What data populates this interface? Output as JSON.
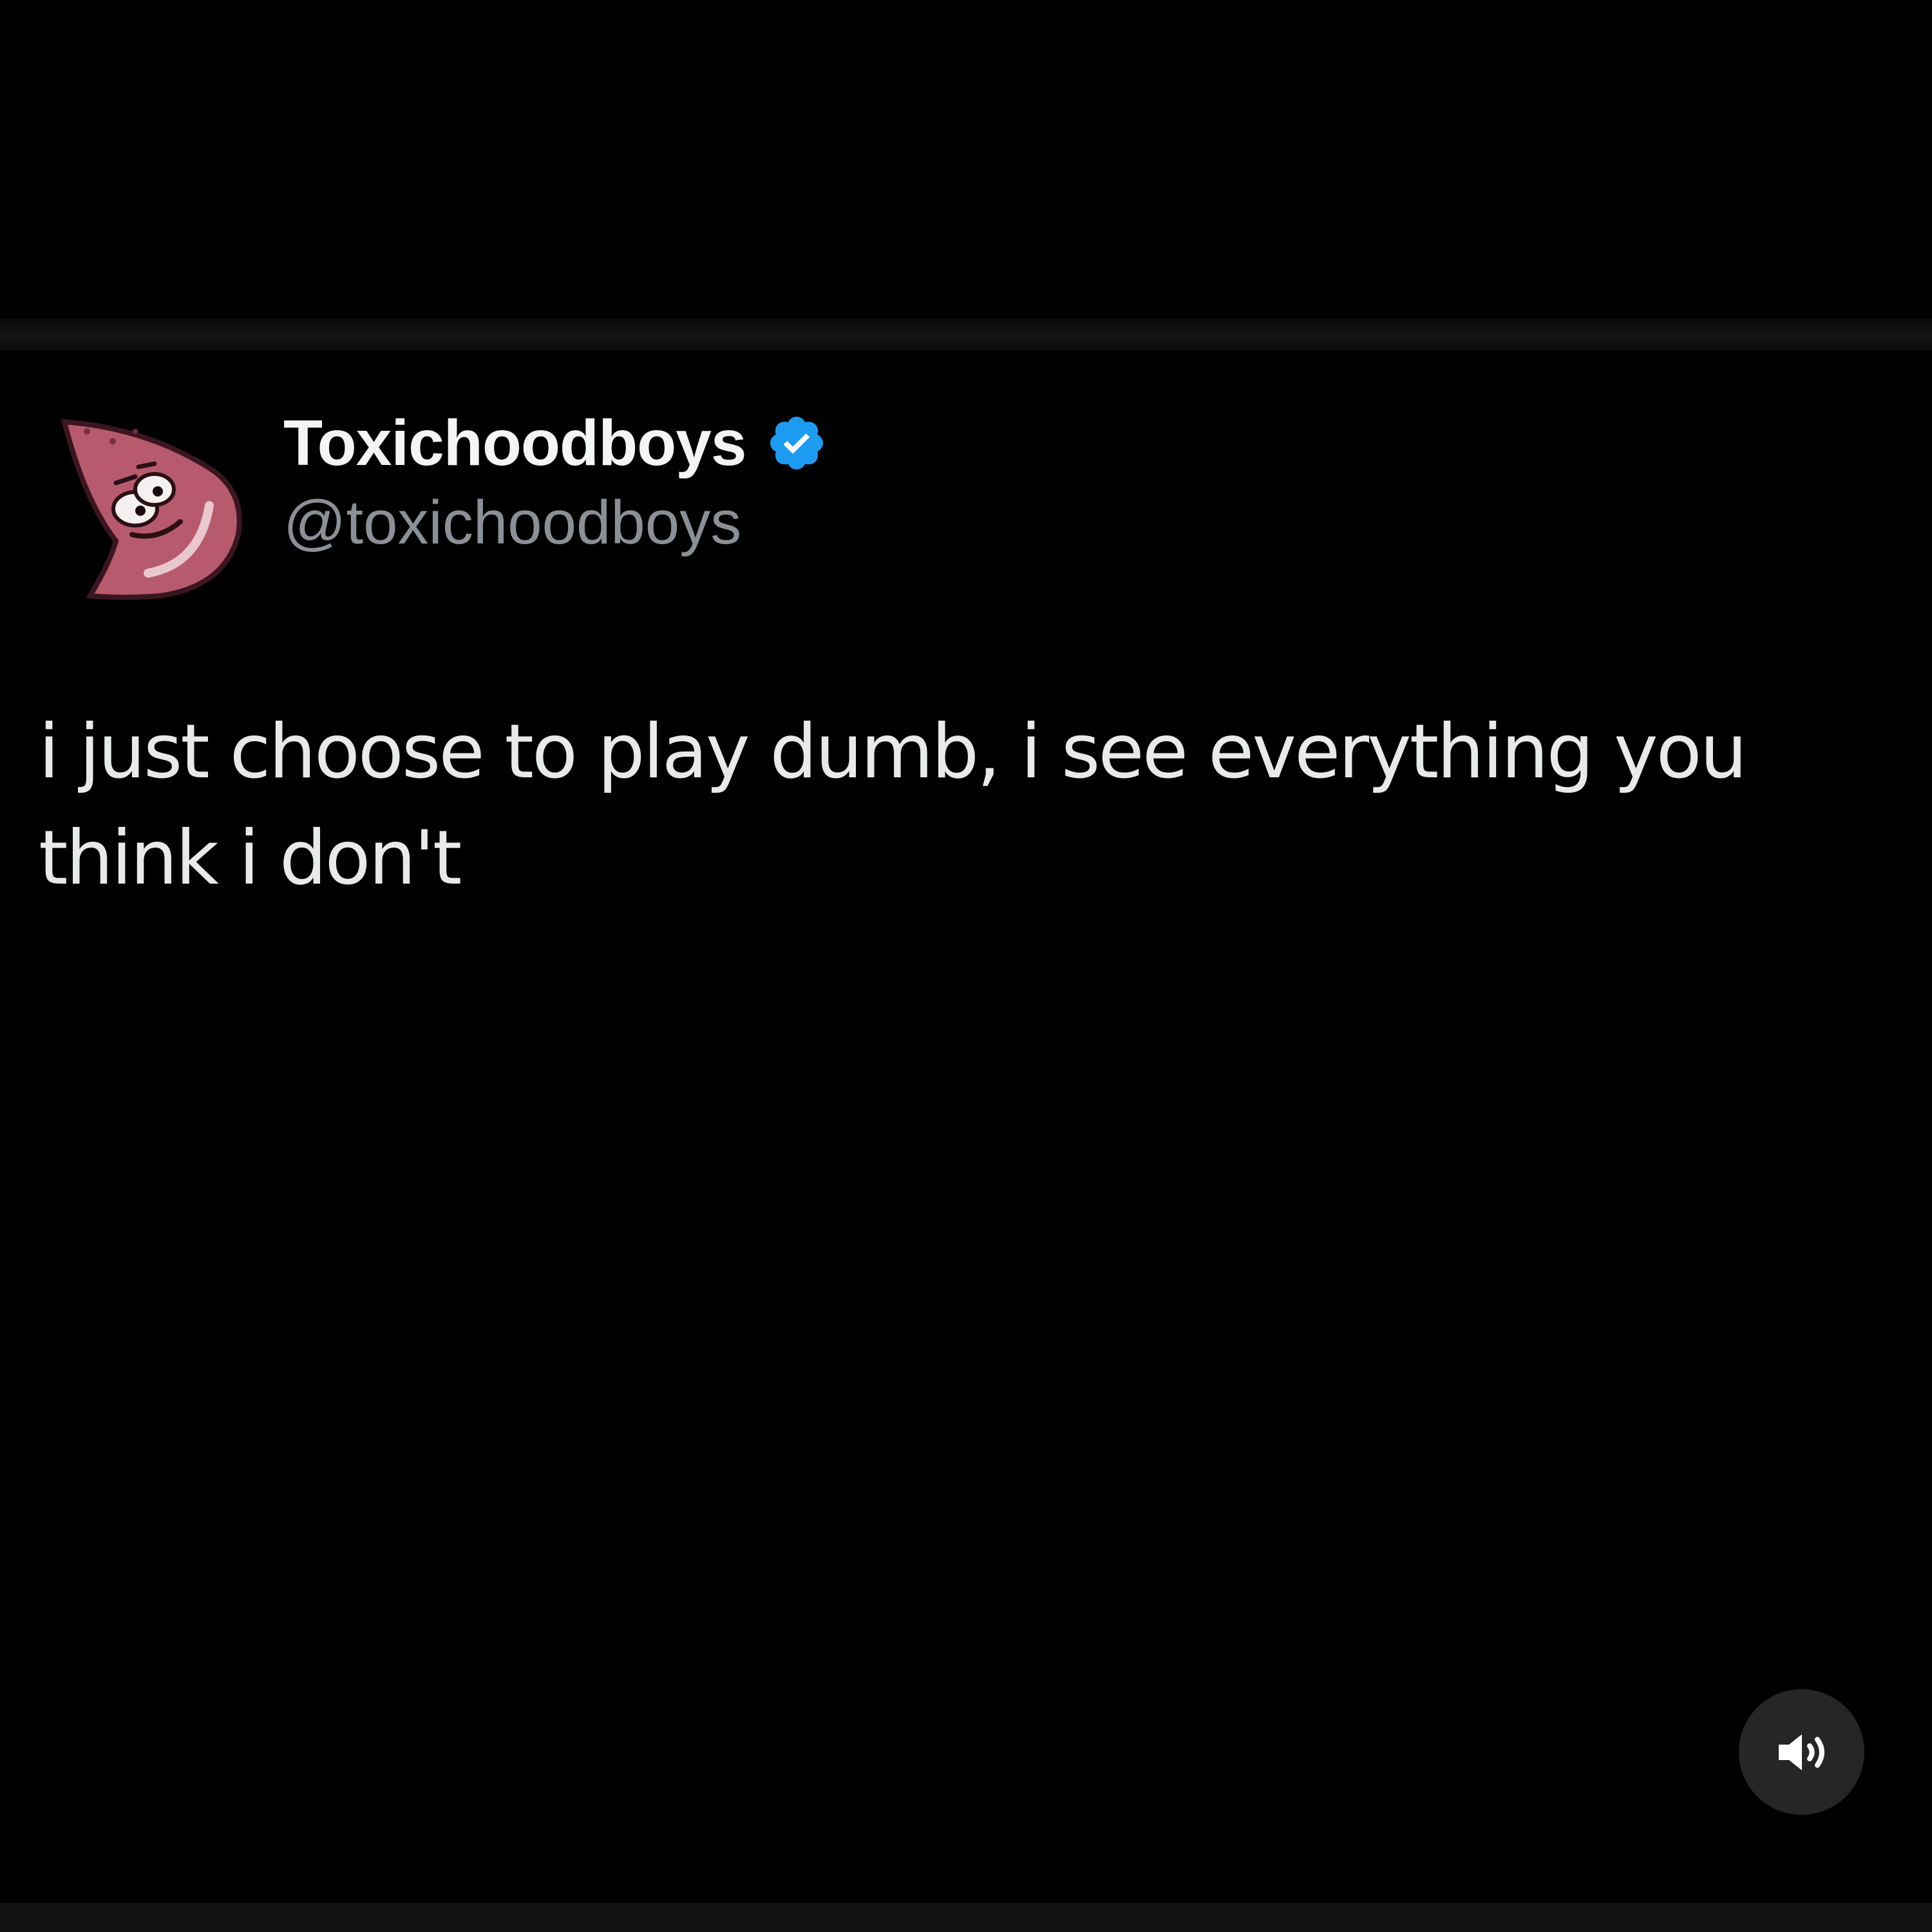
{
  "post": {
    "display_name": "Toxichoodboys",
    "handle": "@toxichoodboys",
    "verified": true,
    "text": "i just choose to play dumb, i see everything you think i don't"
  },
  "icons": {
    "avatar": "cartoon-starfish-avatar",
    "verified": "verified-badge-icon",
    "sound": "speaker-volume-icon"
  },
  "colors": {
    "background": "#000000",
    "name": "#f2f4f5",
    "handle": "#8b9096",
    "text": "#e7e9ea",
    "verified_badge": "#1d9bf0",
    "sound_button_bg": "#262626"
  }
}
